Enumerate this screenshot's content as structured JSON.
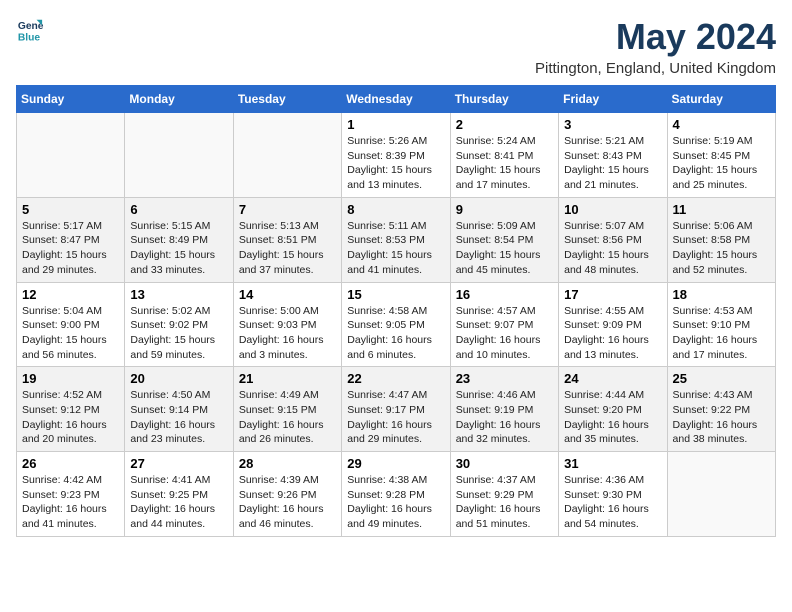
{
  "header": {
    "logo_line1": "General",
    "logo_line2": "Blue",
    "month_title": "May 2024",
    "location": "Pittington, England, United Kingdom"
  },
  "days_of_week": [
    "Sunday",
    "Monday",
    "Tuesday",
    "Wednesday",
    "Thursday",
    "Friday",
    "Saturday"
  ],
  "weeks": [
    [
      {
        "day": "",
        "info": ""
      },
      {
        "day": "",
        "info": ""
      },
      {
        "day": "",
        "info": ""
      },
      {
        "day": "1",
        "info": "Sunrise: 5:26 AM\nSunset: 8:39 PM\nDaylight: 15 hours\nand 13 minutes."
      },
      {
        "day": "2",
        "info": "Sunrise: 5:24 AM\nSunset: 8:41 PM\nDaylight: 15 hours\nand 17 minutes."
      },
      {
        "day": "3",
        "info": "Sunrise: 5:21 AM\nSunset: 8:43 PM\nDaylight: 15 hours\nand 21 minutes."
      },
      {
        "day": "4",
        "info": "Sunrise: 5:19 AM\nSunset: 8:45 PM\nDaylight: 15 hours\nand 25 minutes."
      }
    ],
    [
      {
        "day": "5",
        "info": "Sunrise: 5:17 AM\nSunset: 8:47 PM\nDaylight: 15 hours\nand 29 minutes."
      },
      {
        "day": "6",
        "info": "Sunrise: 5:15 AM\nSunset: 8:49 PM\nDaylight: 15 hours\nand 33 minutes."
      },
      {
        "day": "7",
        "info": "Sunrise: 5:13 AM\nSunset: 8:51 PM\nDaylight: 15 hours\nand 37 minutes."
      },
      {
        "day": "8",
        "info": "Sunrise: 5:11 AM\nSunset: 8:53 PM\nDaylight: 15 hours\nand 41 minutes."
      },
      {
        "day": "9",
        "info": "Sunrise: 5:09 AM\nSunset: 8:54 PM\nDaylight: 15 hours\nand 45 minutes."
      },
      {
        "day": "10",
        "info": "Sunrise: 5:07 AM\nSunset: 8:56 PM\nDaylight: 15 hours\nand 48 minutes."
      },
      {
        "day": "11",
        "info": "Sunrise: 5:06 AM\nSunset: 8:58 PM\nDaylight: 15 hours\nand 52 minutes."
      }
    ],
    [
      {
        "day": "12",
        "info": "Sunrise: 5:04 AM\nSunset: 9:00 PM\nDaylight: 15 hours\nand 56 minutes."
      },
      {
        "day": "13",
        "info": "Sunrise: 5:02 AM\nSunset: 9:02 PM\nDaylight: 15 hours\nand 59 minutes."
      },
      {
        "day": "14",
        "info": "Sunrise: 5:00 AM\nSunset: 9:03 PM\nDaylight: 16 hours\nand 3 minutes."
      },
      {
        "day": "15",
        "info": "Sunrise: 4:58 AM\nSunset: 9:05 PM\nDaylight: 16 hours\nand 6 minutes."
      },
      {
        "day": "16",
        "info": "Sunrise: 4:57 AM\nSunset: 9:07 PM\nDaylight: 16 hours\nand 10 minutes."
      },
      {
        "day": "17",
        "info": "Sunrise: 4:55 AM\nSunset: 9:09 PM\nDaylight: 16 hours\nand 13 minutes."
      },
      {
        "day": "18",
        "info": "Sunrise: 4:53 AM\nSunset: 9:10 PM\nDaylight: 16 hours\nand 17 minutes."
      }
    ],
    [
      {
        "day": "19",
        "info": "Sunrise: 4:52 AM\nSunset: 9:12 PM\nDaylight: 16 hours\nand 20 minutes."
      },
      {
        "day": "20",
        "info": "Sunrise: 4:50 AM\nSunset: 9:14 PM\nDaylight: 16 hours\nand 23 minutes."
      },
      {
        "day": "21",
        "info": "Sunrise: 4:49 AM\nSunset: 9:15 PM\nDaylight: 16 hours\nand 26 minutes."
      },
      {
        "day": "22",
        "info": "Sunrise: 4:47 AM\nSunset: 9:17 PM\nDaylight: 16 hours\nand 29 minutes."
      },
      {
        "day": "23",
        "info": "Sunrise: 4:46 AM\nSunset: 9:19 PM\nDaylight: 16 hours\nand 32 minutes."
      },
      {
        "day": "24",
        "info": "Sunrise: 4:44 AM\nSunset: 9:20 PM\nDaylight: 16 hours\nand 35 minutes."
      },
      {
        "day": "25",
        "info": "Sunrise: 4:43 AM\nSunset: 9:22 PM\nDaylight: 16 hours\nand 38 minutes."
      }
    ],
    [
      {
        "day": "26",
        "info": "Sunrise: 4:42 AM\nSunset: 9:23 PM\nDaylight: 16 hours\nand 41 minutes."
      },
      {
        "day": "27",
        "info": "Sunrise: 4:41 AM\nSunset: 9:25 PM\nDaylight: 16 hours\nand 44 minutes."
      },
      {
        "day": "28",
        "info": "Sunrise: 4:39 AM\nSunset: 9:26 PM\nDaylight: 16 hours\nand 46 minutes."
      },
      {
        "day": "29",
        "info": "Sunrise: 4:38 AM\nSunset: 9:28 PM\nDaylight: 16 hours\nand 49 minutes."
      },
      {
        "day": "30",
        "info": "Sunrise: 4:37 AM\nSunset: 9:29 PM\nDaylight: 16 hours\nand 51 minutes."
      },
      {
        "day": "31",
        "info": "Sunrise: 4:36 AM\nSunset: 9:30 PM\nDaylight: 16 hours\nand 54 minutes."
      },
      {
        "day": "",
        "info": ""
      }
    ]
  ]
}
